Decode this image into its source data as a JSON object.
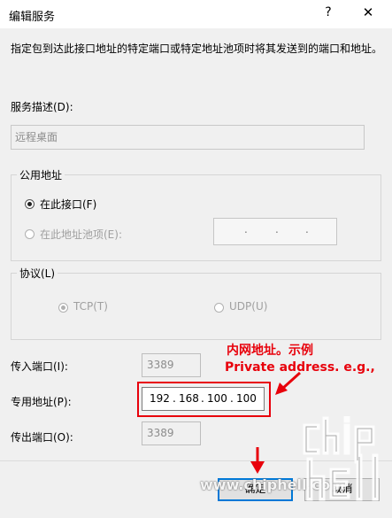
{
  "window": {
    "title": "编辑服务",
    "help_label": "?",
    "close_label": "✕"
  },
  "description": "指定包到达此接口地址的特定端口或特定地址池项时将其发送到的端口和地址。",
  "service_description": {
    "label": "服务描述(D):",
    "value": "远程桌面"
  },
  "public_address": {
    "legend": "公用地址",
    "option_interface": "在此接口(F)",
    "option_pool": "在此地址池项(E):",
    "pool_ip_dots": [
      ".",
      ".",
      "."
    ]
  },
  "protocol": {
    "legend": "协议(L)",
    "tcp_label": "TCP(T)",
    "udp_label": "UDP(U)"
  },
  "incoming_port": {
    "label": "传入端口(I):",
    "value": "3389"
  },
  "private_address": {
    "label": "专用地址(P):",
    "octets": [
      "192",
      "168",
      "100",
      "100"
    ],
    "separator": "."
  },
  "outgoing_port": {
    "label": "传出端口(O):",
    "value": "3389"
  },
  "annotation": {
    "line1": "内网地址。示例",
    "line2": "Private address. e.g.,",
    "color": "#e8000b"
  },
  "buttons": {
    "ok": "确定",
    "cancel": "取消"
  },
  "watermark": {
    "url": "www.chiphell.com",
    "logo": "chip hell"
  }
}
